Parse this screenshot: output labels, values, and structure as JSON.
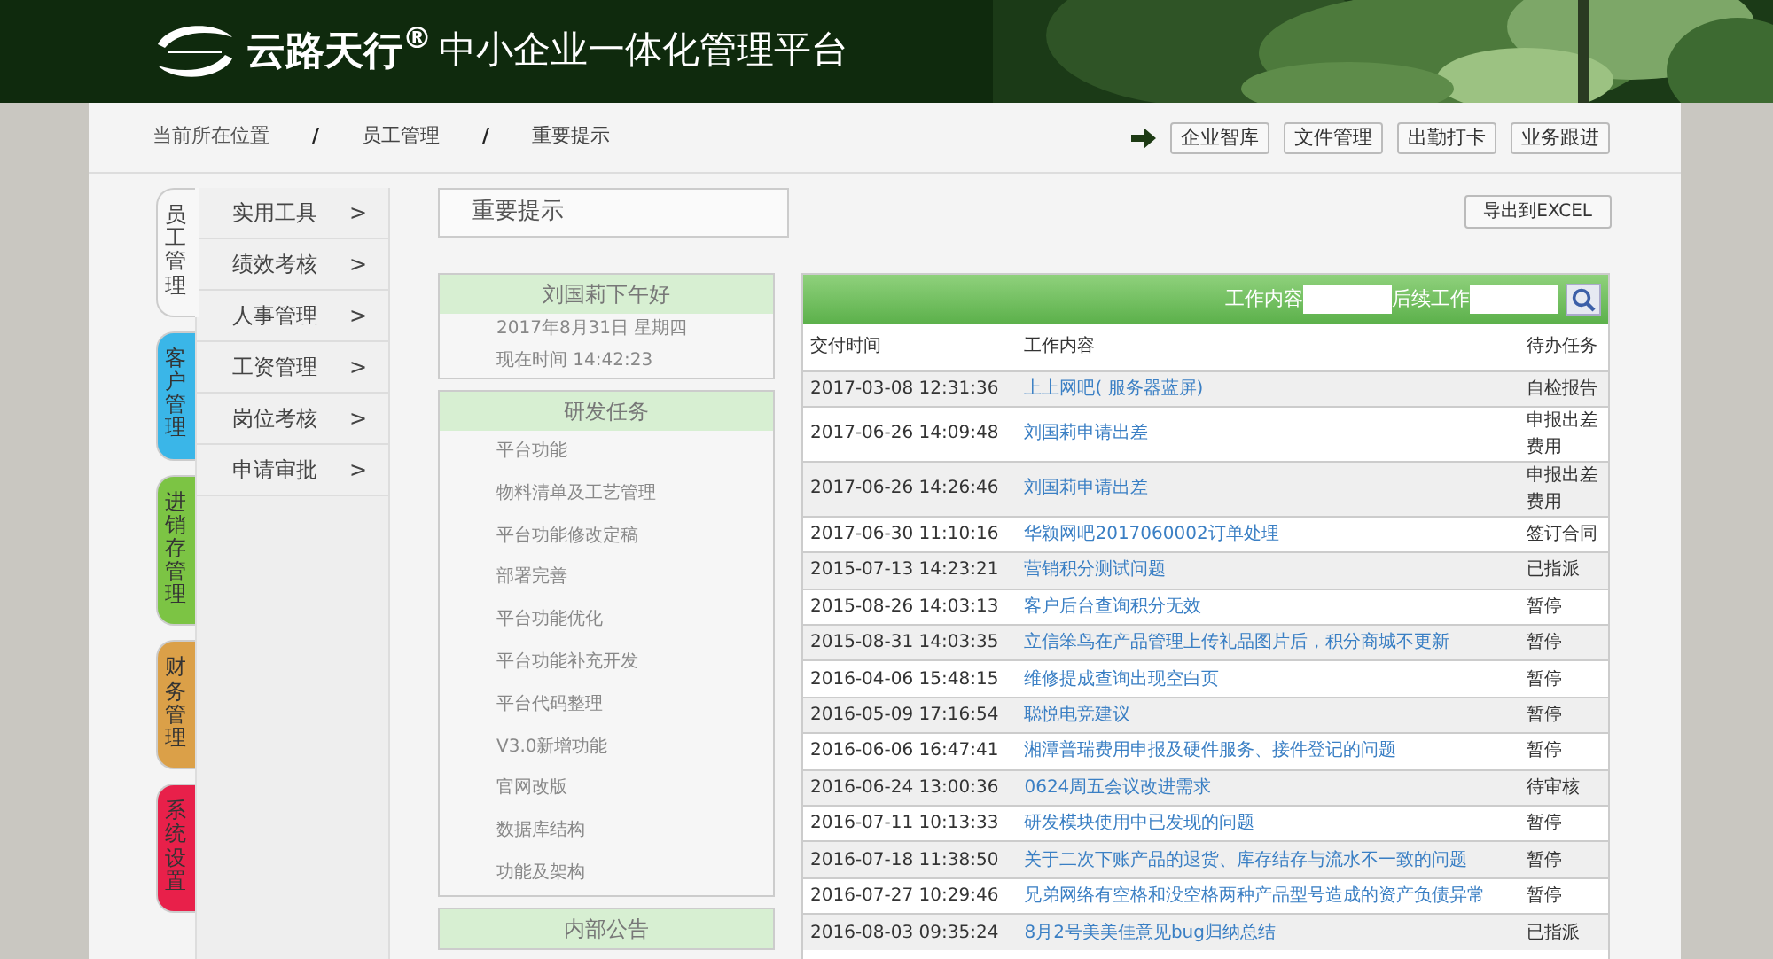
{
  "header": {
    "brand": "云路天行$^{®}$",
    "title": "中小企业一体化管理平台"
  },
  "breadcrumb": [
    {
      "kind": "label",
      "text": "当前所在位置"
    },
    {
      "kind": "separator",
      "text": "/"
    },
    {
      "kind": "link",
      "text": "员工管理"
    },
    {
      "kind": "separator",
      "text": "/"
    },
    {
      "kind": "link",
      "text": "重要提示"
    }
  ],
  "shortcuts": [
    "企业智库",
    "文件管理",
    "出勤打卡",
    "业务跟进"
  ],
  "module_tabs": [
    {
      "label": "员工管理",
      "selected": true,
      "color": "#f7f7f7"
    },
    {
      "label": "客户管理",
      "selected": false,
      "color": "#3ab6e8"
    },
    {
      "label": "进销存管理",
      "selected": false,
      "color": "#7cc444"
    },
    {
      "label": "财务管理",
      "selected": false,
      "color": "#dba048"
    },
    {
      "label": "系统设置",
      "selected": false,
      "color": "#e8204a"
    }
  ],
  "menu": [
    {
      "label": "实用工具",
      "arrow": ">"
    },
    {
      "label": "绩效考核",
      "arrow": ">"
    },
    {
      "label": "人事管理",
      "arrow": ">"
    },
    {
      "label": "工资管理",
      "arrow": ">"
    },
    {
      "label": "岗位考核",
      "arrow": ">"
    },
    {
      "label": "申请审批",
      "arrow": ">"
    }
  ],
  "page_title": "重要提示",
  "export_button": "导出到EXCEL",
  "greeting": {
    "title": "刘国莉下午好",
    "date": "2017年8月31日  星期四",
    "time": "现在时间  14:42:23"
  },
  "tasks": {
    "title": "研发任务",
    "items": [
      "平台功能",
      "物料清单及工艺管理",
      "平台功能修改定稿",
      "部署完善",
      "平台功能优化",
      "平台功能补充开发",
      "平台代码整理",
      "V3.0新增功能",
      "官网改版",
      "数据库结构",
      "功能及架构"
    ]
  },
  "notice": {
    "title": "内部公告"
  },
  "search": {
    "content_label": "工作内容",
    "followup_label": "后续工作"
  },
  "table": {
    "columns": [
      "交付时间",
      "工作内容",
      "待办任务"
    ],
    "rows": [
      [
        "2017-03-08 12:31:36",
        "上上网吧( 服务器蓝屏)",
        "自检报告"
      ],
      [
        "2017-06-26 14:09:48",
        "刘国莉申请出差",
        "申报出差费用"
      ],
      [
        "2017-06-26 14:26:46",
        "刘国莉申请出差",
        "申报出差费用"
      ],
      [
        "2017-06-30 11:10:16",
        "华颖网吧2017060002订单处理",
        "签订合同"
      ],
      [
        "2015-07-13 14:23:21",
        "营销积分测试问题",
        "已指派"
      ],
      [
        "2015-08-26 14:03:13",
        "客户后台查询积分无效",
        "暂停"
      ],
      [
        "2015-08-31 14:03:35",
        "立信笨鸟在产品管理上传礼品图片后，积分商城不更新",
        "暂停"
      ],
      [
        "2016-04-06 15:48:15",
        "维修提成查询出现空白页",
        "暂停"
      ],
      [
        "2016-05-09 17:16:54",
        "聪悦电竞建议",
        "暂停"
      ],
      [
        "2016-06-06 16:47:41",
        "湘潭普瑞费用申报及硬件服务、接件登记的问题",
        "暂停"
      ],
      [
        "2016-06-24 13:00:36",
        "0624周五会议改进需求",
        "待审核"
      ],
      [
        "2016-07-11 10:13:33",
        "研发模块使用中已发现的问题",
        "暂停"
      ],
      [
        "2016-07-18 11:38:50",
        "关于二次下账产品的退货、库存结存与流水不一致的问题",
        "暂停"
      ],
      [
        "2016-07-27 10:29:46",
        "兄弟网络有空格和没空格两种产品型号造成的资产负债异常",
        "暂停"
      ],
      [
        "2016-08-03 09:35:24",
        "8月2号美美佳意见bug归纳总结",
        "已指派"
      ]
    ]
  }
}
